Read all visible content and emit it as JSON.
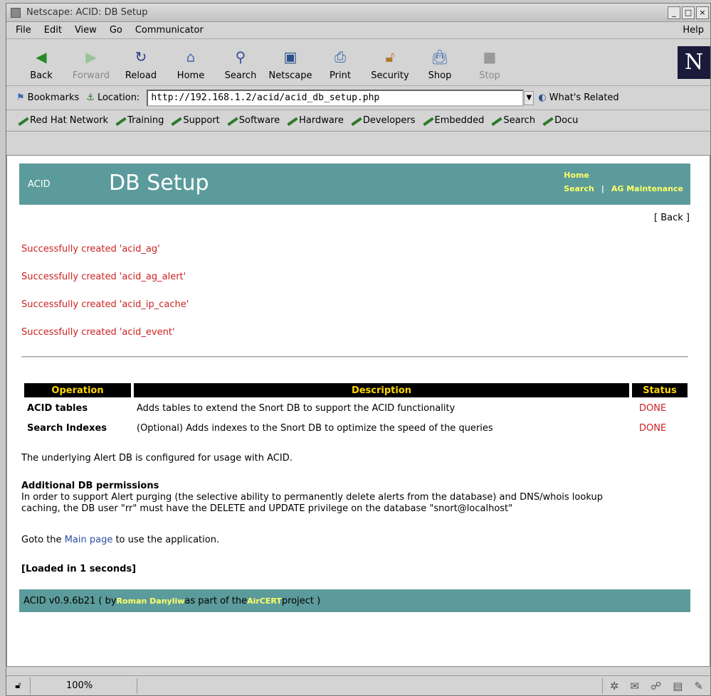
{
  "window": {
    "title": "Netscape: ACID: DB Setup"
  },
  "menu": {
    "items": [
      "File",
      "Edit",
      "View",
      "Go",
      "Communicator"
    ],
    "help": "Help"
  },
  "toolbar": {
    "back": "Back",
    "forward": "Forward",
    "reload": "Reload",
    "home": "Home",
    "search": "Search",
    "netscape": "Netscape",
    "print": "Print",
    "security": "Security",
    "shop": "Shop",
    "stop": "Stop"
  },
  "location": {
    "bookmarks": "Bookmarks",
    "label": "Location:",
    "url": "http://192.168.1.2/acid/acid_db_setup.php",
    "related": "What's Related"
  },
  "personal_toolbar": [
    "Red Hat Network",
    "Training",
    "Support",
    "Software",
    "Hardware",
    "Developers",
    "Embedded",
    "Search",
    "Docu"
  ],
  "page": {
    "header": {
      "brand": "ACID",
      "title": "DB Setup",
      "link_home": "Home",
      "link_search": "Search",
      "separator": "|",
      "link_ag": "AG Maintenance"
    },
    "back_link": "[ Back ]",
    "messages": [
      "Successfully created 'acid_ag'",
      "Successfully created 'acid_ag_alert'",
      "Successfully created 'acid_ip_cache'",
      "Successfully created 'acid_event'"
    ],
    "table": {
      "headers": [
        "Operation",
        "Description",
        "Status"
      ],
      "rows": [
        {
          "op": "ACID tables",
          "desc": "Adds tables to extend the Snort DB to support the ACID functionality",
          "status": "DONE"
        },
        {
          "op": "Search Indexes",
          "desc": "(Optional) Adds indexes to the Snort DB to optimize the speed of the queries",
          "status": "DONE"
        }
      ]
    },
    "configured_text": "The underlying Alert DB is configured for usage with ACID.",
    "permissions_title": "Additional DB permissions",
    "permissions_text_1": "In order to support Alert purging (the selective ability to permanently delete alerts from the database) and DNS/whois lookup",
    "permissions_text_2": "caching, the DB user \"rr\" must have the DELETE and UPDATE privilege on the database \"snort@localhost\"",
    "goto_prefix": "Goto the ",
    "goto_link": "Main page",
    "goto_suffix": " to use the application.",
    "loaded": "[Loaded in 1 seconds]",
    "footer": {
      "prefix": "ACID v0.9.6b21 ( by ",
      "author": "Roman Danyliw",
      "middle": " as part of the ",
      "project": "AirCERT",
      "suffix": " project )"
    }
  },
  "status": {
    "progress": "100%"
  }
}
